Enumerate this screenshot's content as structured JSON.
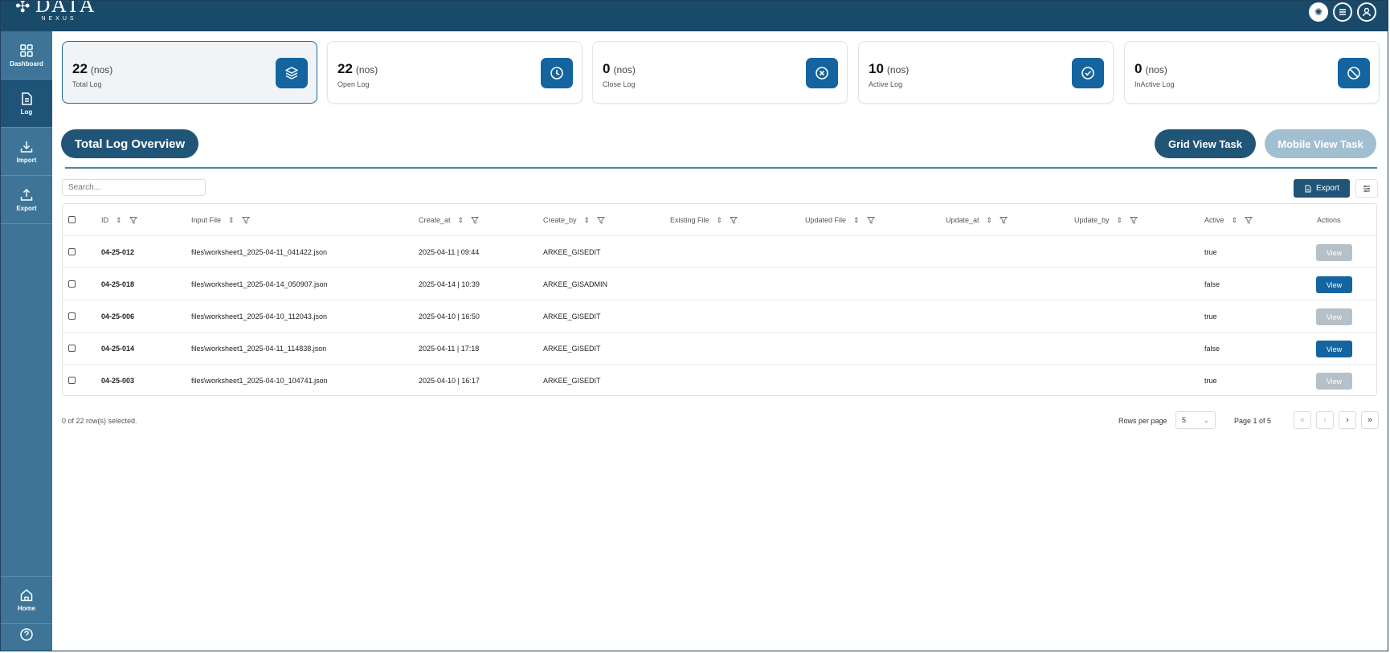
{
  "brand": {
    "name": "DATA",
    "sub": "NEXUS"
  },
  "sidebar": {
    "items": [
      {
        "label": "Dashboard",
        "icon": "grid-icon"
      },
      {
        "label": "Log",
        "icon": "document-icon"
      },
      {
        "label": "Import",
        "icon": "download-icon"
      },
      {
        "label": "Export",
        "icon": "upload-icon"
      }
    ],
    "bottom": [
      {
        "label": "Home",
        "icon": "home-icon"
      },
      {
        "label": "",
        "icon": "help-icon"
      }
    ]
  },
  "cards": [
    {
      "value": "22",
      "unit": "(nos)",
      "label": "Total Log",
      "icon": "layers-icon"
    },
    {
      "value": "22",
      "unit": "(nos)",
      "label": "Open Log",
      "icon": "clock-icon"
    },
    {
      "value": "0",
      "unit": "(nos)",
      "label": "Close Log",
      "icon": "close-circle-icon"
    },
    {
      "value": "10",
      "unit": "(nos)",
      "label": "Active Log",
      "icon": "check-circle-icon"
    },
    {
      "value": "0",
      "unit": "(nos)",
      "label": "InActive Log",
      "icon": "block-icon"
    }
  ],
  "actions": {
    "overview": "Total Log Overview",
    "grid_view": "Grid View Task",
    "mobile_view": "Mobile View Task",
    "export": "Export"
  },
  "search": {
    "placeholder": "Search..."
  },
  "table": {
    "columns": [
      "ID",
      "Input File",
      "Create_at",
      "Create_by",
      "Existing File",
      "Updated File",
      "Update_at",
      "Update_by",
      "Active",
      "Actions"
    ],
    "rows": [
      {
        "id": "04-25-012",
        "input_file": "files\\worksheet1_2025-04-11_041422.json",
        "create_at": "2025-04-11 | 09:44",
        "create_by": "ARKEE_GISEDIT",
        "active": "true",
        "action": "View"
      },
      {
        "id": "04-25-018",
        "input_file": "files\\worksheet1_2025-04-14_050907.json",
        "create_at": "2025-04-14 | 10:39",
        "create_by": "ARKEE_GISADMIN",
        "active": "false",
        "action": "View"
      },
      {
        "id": "04-25-006",
        "input_file": "files\\worksheet1_2025-04-10_112043.json",
        "create_at": "2025-04-10 | 16:50",
        "create_by": "ARKEE_GISEDIT",
        "active": "true",
        "action": "View"
      },
      {
        "id": "04-25-014",
        "input_file": "files\\worksheet1_2025-04-11_114838.json",
        "create_at": "2025-04-11 | 17:18",
        "create_by": "ARKEE_GISEDIT",
        "active": "false",
        "action": "View"
      },
      {
        "id": "04-25-003",
        "input_file": "files\\worksheet1_2025-04-10_104741.json",
        "create_at": "2025-04-10 | 16:17",
        "create_by": "ARKEE_GISEDIT",
        "active": "true",
        "action": "View"
      }
    ]
  },
  "footer": {
    "selection": "0 of 22 row(s) selected.",
    "rows_per_page_label": "Rows per page",
    "rows_per_page": "5",
    "page_info": "Page 1 of 5"
  },
  "colors": {
    "topbar": "#1a4a69",
    "sidebar": "#3e7497",
    "accent": "#1464a0",
    "disabled": "#b6c0c8"
  }
}
